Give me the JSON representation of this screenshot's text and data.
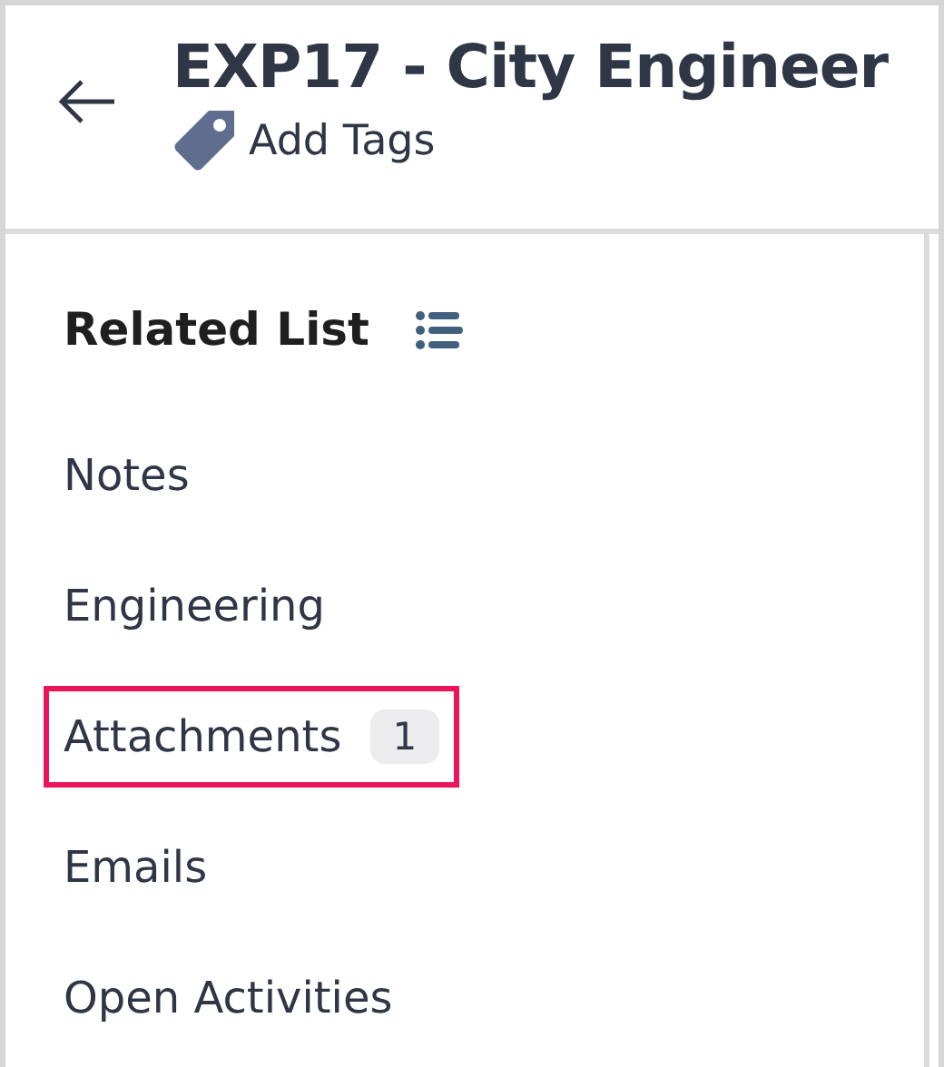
{
  "header": {
    "title": "EXP17 - City Engineer",
    "tags_label": "Add Tags"
  },
  "related_list": {
    "title": "Related List",
    "items": [
      {
        "label": "Notes",
        "highlighted": false
      },
      {
        "label": "Engineering",
        "highlighted": false
      },
      {
        "label": "Attachments",
        "count": "1",
        "highlighted": true
      },
      {
        "label": "Emails",
        "highlighted": false
      },
      {
        "label": "Open Activities",
        "highlighted": false
      }
    ]
  }
}
